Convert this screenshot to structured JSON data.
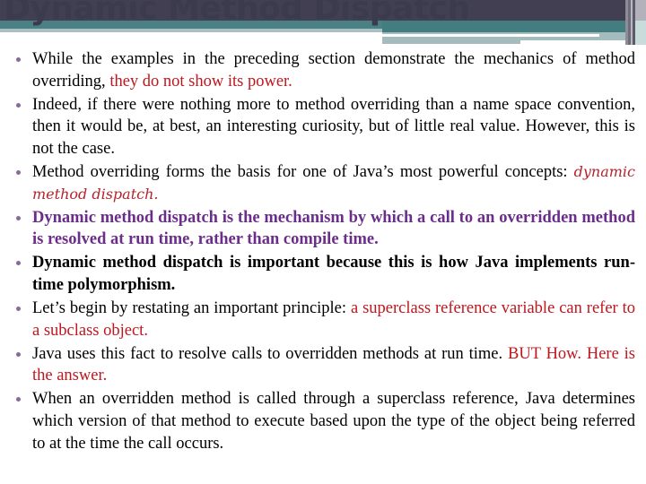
{
  "slide": {
    "title": "Dynamic Method Dispatch",
    "colors": {
      "header_dark": "#413f51",
      "header_teal": "#4b8185",
      "header_gray": "#a4bcbe",
      "title_text": "#3c3a4d",
      "bullet": "#8a6a96",
      "emphasis_red": "#c0161e",
      "emphasis_purple": "#6b2d8a"
    },
    "bullets": [
      {
        "text": "While the examples in the preceding section demonstrate the mechanics of method overriding, ",
        "emphasis": "they do not show its power."
      },
      {
        "text": "Indeed, if there were nothing more to method overriding than a name space convention, then it would be, at best, an interesting curiosity, but of little real value. However, this is not the case."
      },
      {
        "text": "Method overriding forms the basis for one of Java’s most powerful concepts: ",
        "emphasis": "dynamic method dispatch."
      },
      {
        "text": "Dynamic method dispatch is the mechanism by which a call to an overridden method is resolved at run time, rather than compile time."
      },
      {
        "text": "Dynamic method dispatch is important because this is how Java implements run-time polymorphism."
      },
      {
        "text": "Let’s begin by restating an important principle: ",
        "emphasis": "a superclass reference variable can refer to a subclass object."
      },
      {
        "text": "Java uses this fact to resolve calls to overridden methods at run time. ",
        "emphasis": "BUT How. Here is the answer."
      },
      {
        "text": "When an overridden method is called through a superclass reference, Java determines which version of that method to execute based upon the type of the object being referred to at the time the call occurs."
      }
    ]
  }
}
